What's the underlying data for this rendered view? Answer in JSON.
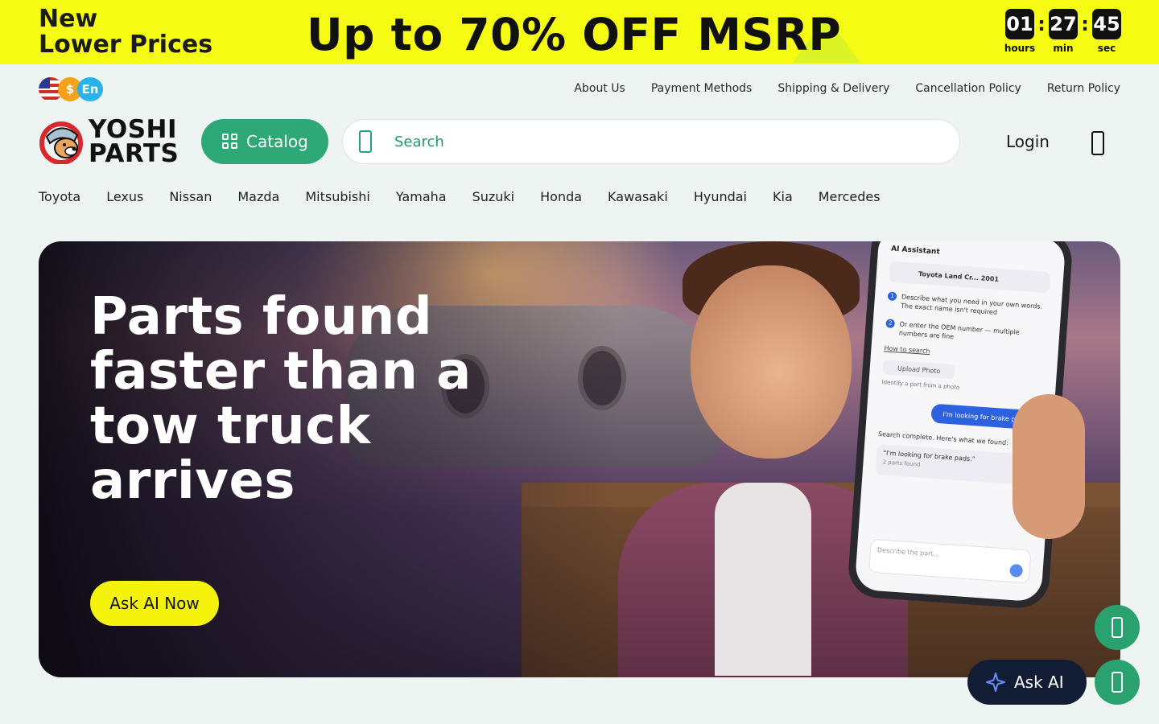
{
  "promo": {
    "subtitle": "New\nLower Prices",
    "headline": "Up to 70% OFF MSRP",
    "countdown": {
      "hours": "01",
      "hours_label": "hours",
      "minutes": "27",
      "minutes_label": "min",
      "seconds": "45",
      "seconds_label": "sec",
      "separator": ":"
    }
  },
  "locale": {
    "currency": "$",
    "language": "En"
  },
  "top_links": [
    "About Us",
    "Payment Methods",
    "Shipping & Delivery",
    "Cancellation Policy",
    "Return Policy"
  ],
  "header": {
    "logo_text": "YOSHI\nPARTS",
    "catalog_label": "Catalog",
    "search_placeholder": "Search",
    "login_label": "Login"
  },
  "brands": [
    "Toyota",
    "Lexus",
    "Nissan",
    "Mazda",
    "Mitsubishi",
    "Yamaha",
    "Suzuki",
    "Honda",
    "Kawasaki",
    "Hyundai",
    "Kia",
    "Mercedes"
  ],
  "hero": {
    "title": "Parts found faster than a tow truck arrives",
    "cta_label": "Ask AI Now",
    "phone": {
      "title": "AI Assistant",
      "car": "Toyota Land Cr... 2001",
      "step1": "Describe what you need in your own words. The exact name isn't required",
      "step2": "Or enter the OEM number — multiple numbers are fine",
      "how_to": "How to search",
      "upload": "Upload Photo",
      "upload_hint": "Identify a part from a photo",
      "user_message": "I'm looking for brake pads.",
      "result_title": "Search complete. Here's what we found:",
      "result_query": "\"I'm looking for brake pads.\"",
      "result_count": "2 parts found",
      "input_placeholder": "Describe the part..."
    }
  },
  "floating": {
    "ask_ai_label": "Ask AI"
  },
  "colors": {
    "promo_bg": "#f5fb13",
    "brand_green": "#2ea877",
    "cta_yellow": "#f5f20b",
    "ask_ai_bg": "#121d35"
  },
  "icons": [
    "catalog-grid-icon",
    "search-icon",
    "cart-icon",
    "sparkle-icon",
    "chat-icon",
    "phone-icon"
  ]
}
